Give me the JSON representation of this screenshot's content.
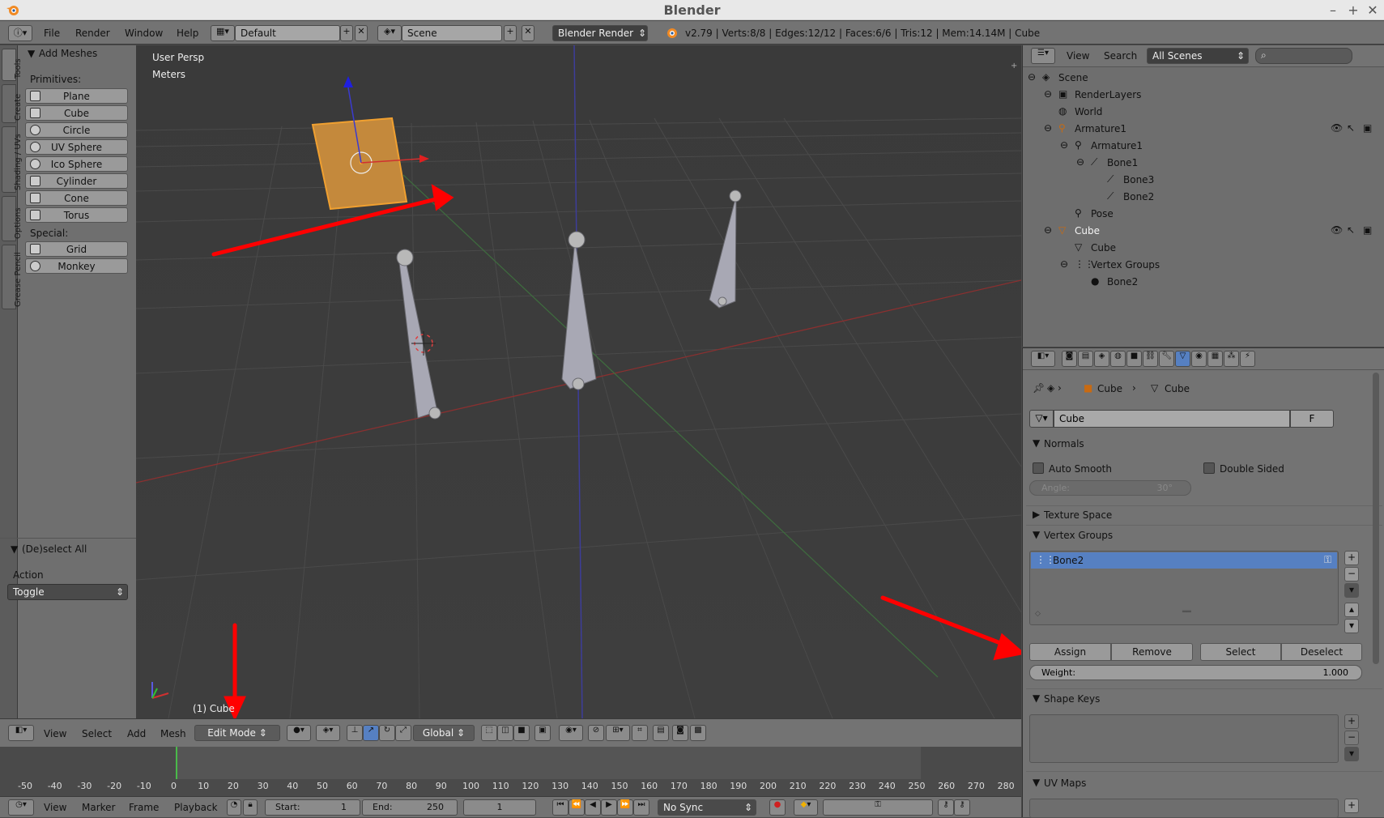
{
  "window": {
    "title": "Blender"
  },
  "info_bar": {
    "menus": [
      "File",
      "Render",
      "Window",
      "Help"
    ],
    "layout": "Default",
    "scene": "Scene",
    "engine": "Blender Render",
    "stats": "v2.79 | Verts:8/8 | Edges:12/12 | Faces:6/6 | Tris:12 | Mem:14.14M | Cube"
  },
  "toolshelf": {
    "tabs": [
      "Tools",
      "Create",
      "Shading / UVs",
      "Options",
      "Grease Pencil"
    ],
    "panel_title": "Add Meshes",
    "primitives_label": "Primitives:",
    "primitives": [
      "Plane",
      "Cube",
      "Circle",
      "UV Sphere",
      "Ico Sphere",
      "Cylinder",
      "Cone",
      "Torus"
    ],
    "special_label": "Special:",
    "special": [
      "Grid",
      "Monkey"
    ],
    "op_title": "(De)select All",
    "action_label": "Action",
    "action_value": "Toggle"
  },
  "viewport": {
    "view_name": "User Persp",
    "units": "Meters",
    "object_label": "(1) Cube"
  },
  "viewport_header": {
    "menus": [
      "View",
      "Select",
      "Add",
      "Mesh"
    ],
    "mode": "Edit Mode",
    "orientation": "Global"
  },
  "timeline": {
    "ticks": [
      "-50",
      "-40",
      "-30",
      "-20",
      "-10",
      "0",
      "10",
      "20",
      "30",
      "40",
      "50",
      "60",
      "70",
      "80",
      "90",
      "100",
      "110",
      "120",
      "130",
      "140",
      "150",
      "160",
      "170",
      "180",
      "190",
      "200",
      "210",
      "220",
      "230",
      "240",
      "250",
      "260",
      "270",
      "280"
    ],
    "menus": [
      "View",
      "Marker",
      "Frame",
      "Playback"
    ],
    "start_label": "Start:",
    "start_value": "1",
    "end_label": "End:",
    "end_value": "250",
    "current_frame": "1",
    "sync": "No Sync"
  },
  "outliner": {
    "menus": [
      "View",
      "Search"
    ],
    "filter": "All Scenes",
    "items": [
      "Scene",
      "RenderLayers",
      "World",
      "Armature1",
      "Armature1",
      "Bone1",
      "Bone3",
      "Bone2",
      "Pose",
      "Cube",
      "Cube",
      "Vertex Groups",
      "Bone2"
    ]
  },
  "properties": {
    "breadcrumb": [
      "Cube",
      "Cube"
    ],
    "datablock_name": "Cube",
    "datablock_fake": "F",
    "normals_title": "Normals",
    "auto_smooth": "Auto Smooth",
    "double_sided": "Double Sided",
    "angle_label": "Angle:",
    "angle_value": "30°",
    "texture_space": "Texture Space",
    "vertex_groups_title": "Vertex Groups",
    "vertex_group_item": "Bone2",
    "assign": "Assign",
    "remove": "Remove",
    "select": "Select",
    "deselect": "Deselect",
    "weight_label": "Weight:",
    "weight_value": "1.000",
    "shape_keys_title": "Shape Keys",
    "uv_maps_title": "UV Maps"
  },
  "colors": {
    "selection": "#f0a030",
    "highlight": "#5680c2",
    "annotation_arrow": "#ff0000"
  }
}
